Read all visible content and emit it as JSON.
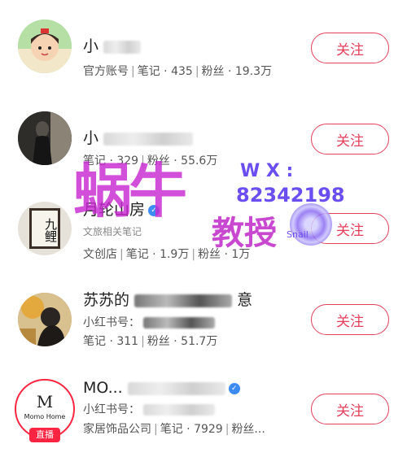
{
  "follow_label": "关注",
  "users": [
    {
      "name": "小",
      "line1": {
        "label": "官方账号",
        "notes_label": "笔记",
        "notes": "435",
        "fans_label": "粉丝",
        "fans": "19.3万"
      }
    },
    {
      "name": "小",
      "line1": {
        "notes_label": "笔记",
        "notes": "329",
        "fans_label": "粉丝",
        "fans": "55.6万"
      }
    },
    {
      "name": "月轮山房",
      "avatar_text": "九鲤",
      "line1": {
        "label": "文旅相关笔记"
      },
      "line2": {
        "label": "文创店",
        "notes_label": "笔记",
        "notes": "1.9万",
        "fans_label": "粉丝",
        "fans": "1万"
      }
    },
    {
      "name": "苏苏的",
      "name_tail": "意",
      "line1": {
        "label": "小红书号："
      },
      "line2": {
        "notes_label": "笔记",
        "notes": "311",
        "fans_label": "粉丝",
        "fans": "51.7万"
      }
    },
    {
      "name": "MO...",
      "avatar_text": "M",
      "avatar_sub": "Momo Home",
      "live_label": "直播",
      "line1": {
        "label": "小红书号："
      },
      "line2": {
        "label": "家居饰品公司",
        "notes_label": "笔记",
        "notes": "7929",
        "fans_label": "粉丝..."
      }
    }
  ],
  "watermark": {
    "text1": "蜗牛",
    "text2": "教授",
    "wx": "W X :",
    "number": "82342198",
    "brand": "Snail"
  },
  "colors": {
    "accent": "#e4405c",
    "live": "#ff2442",
    "verified": "#3d8cf5"
  }
}
